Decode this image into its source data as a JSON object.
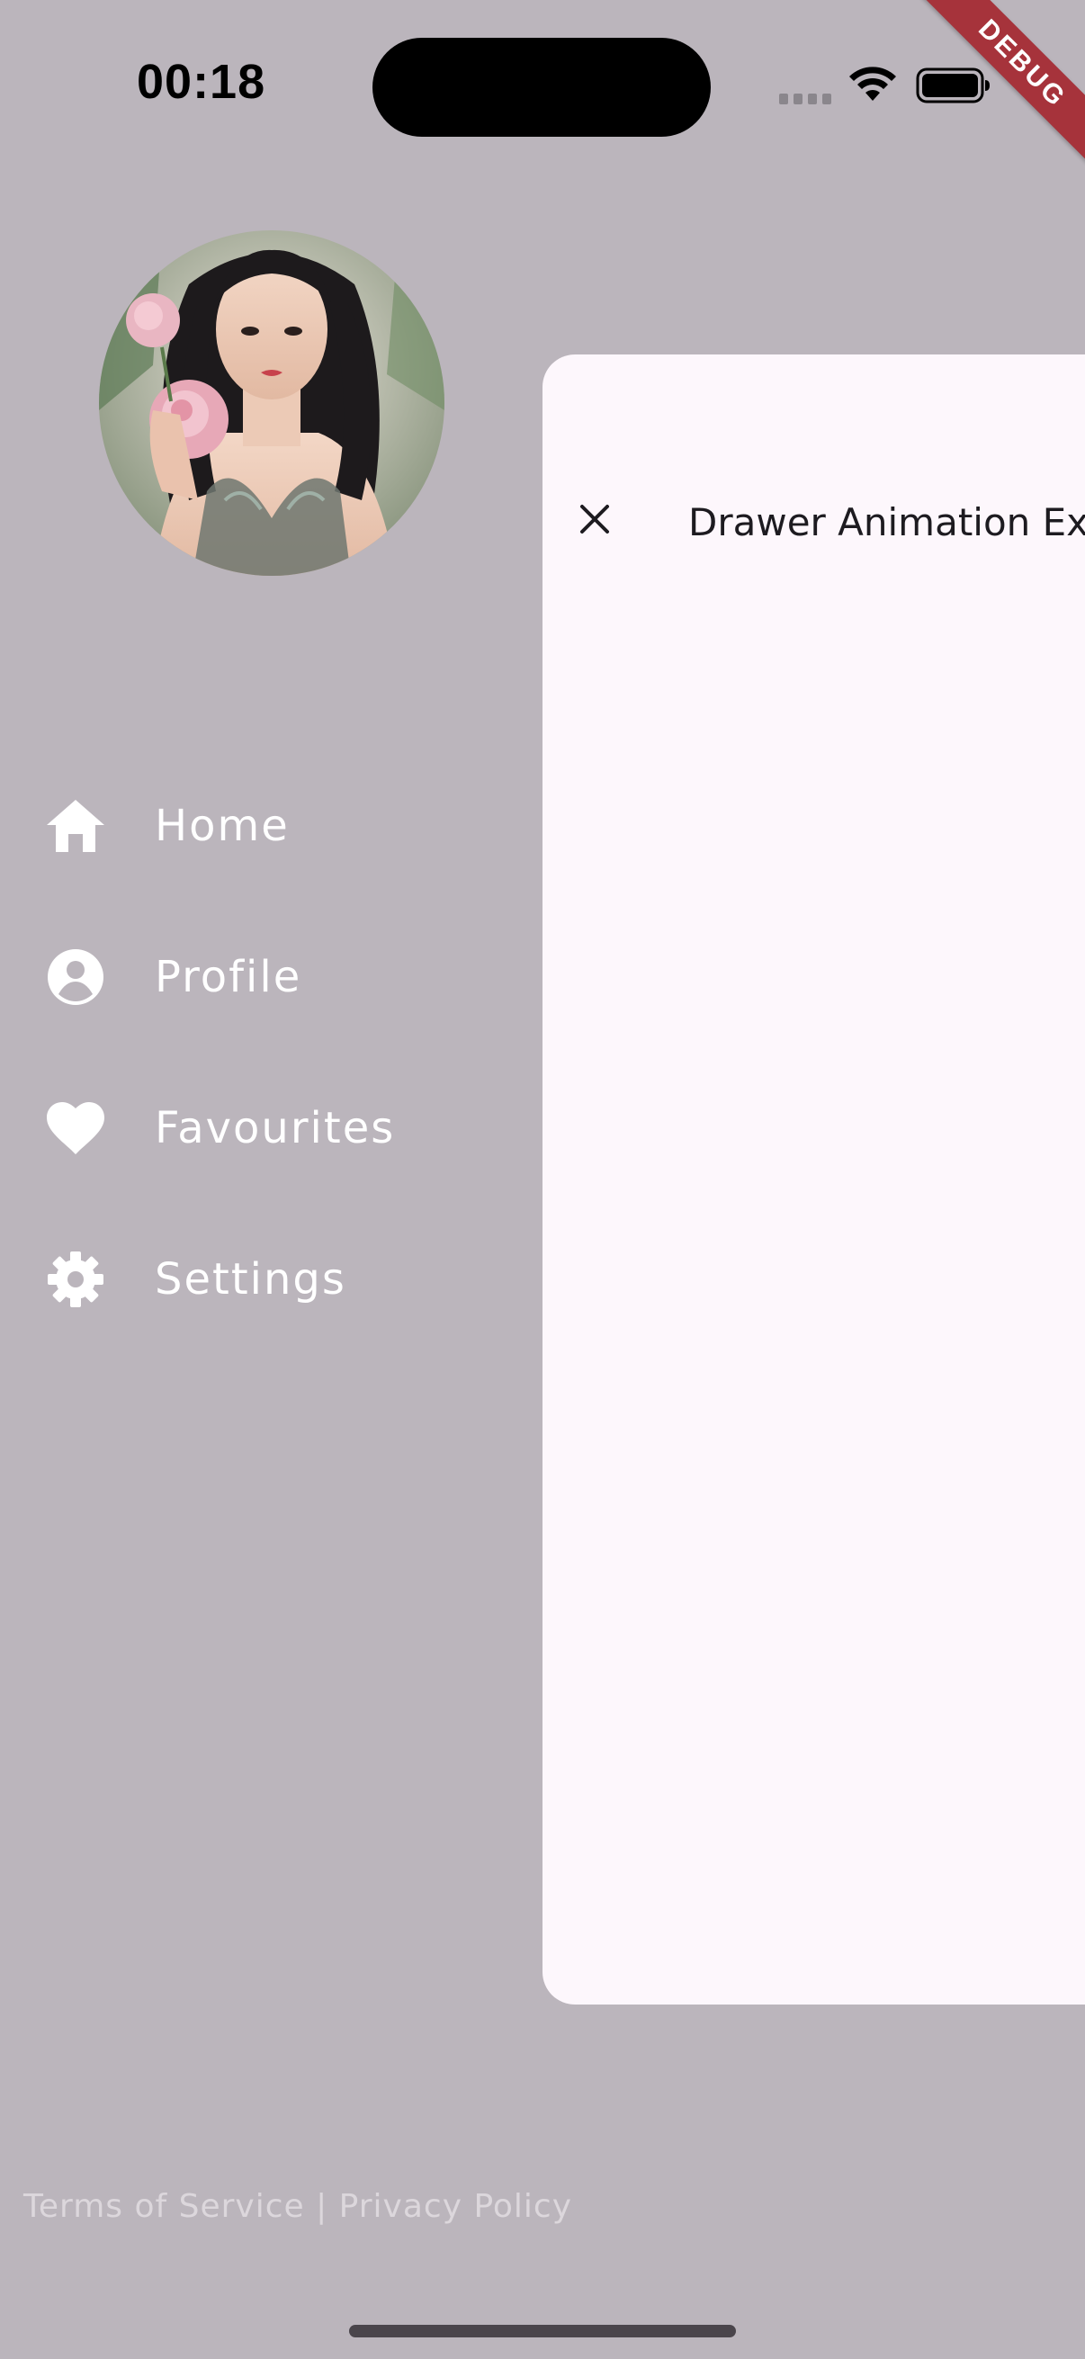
{
  "status_bar": {
    "time": "00:18"
  },
  "debug_banner": "DEBUG",
  "drawer": {
    "menu": [
      {
        "label": "Home",
        "icon": "home-icon"
      },
      {
        "label": "Profile",
        "icon": "account-circle-icon"
      },
      {
        "label": "Favourites",
        "icon": "heart-icon"
      },
      {
        "label": "Settings",
        "icon": "gear-icon"
      }
    ],
    "footer": {
      "terms": "Terms of Service",
      "separator": " | ",
      "privacy": "Privacy Policy"
    }
  },
  "main": {
    "app_bar_title": "Drawer Animation Example"
  },
  "colors": {
    "drawer_background": "#bbb5bc",
    "card_background": "#fdf7fc",
    "debug_ribbon": "#a6333b",
    "menu_text": "#ffffff",
    "footer_text": "#dcd7dc"
  }
}
